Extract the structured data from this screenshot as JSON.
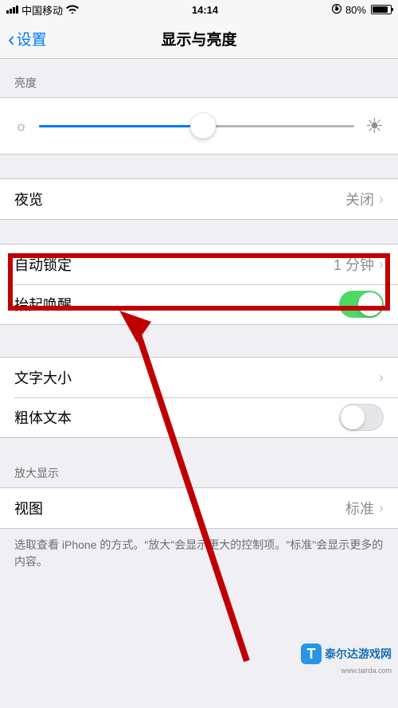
{
  "status_bar": {
    "carrier": "中国移动",
    "time": "14:14",
    "battery": "80%"
  },
  "nav": {
    "back": "设置",
    "title": "显示与亮度"
  },
  "sections": {
    "brightness_header": "亮度",
    "brightness_value": 52,
    "night_shift": {
      "label": "夜览",
      "value": "关闭"
    },
    "auto_lock": {
      "label": "自动锁定",
      "value": "1 分钟"
    },
    "raise_to_wake": {
      "label": "抬起唤醒",
      "on": true
    },
    "text_size": {
      "label": "文字大小"
    },
    "bold_text": {
      "label": "粗体文本",
      "on": false
    },
    "zoom_header": "放大显示",
    "view": {
      "label": "视图",
      "value": "标准"
    },
    "view_footer": "选取查看 iPhone 的方式。\"放大\"会显示更大的控制项。\"标准\"会显示更多的内容。"
  },
  "watermark": {
    "name": "泰尔达游戏网",
    "url": "www.tairda.com"
  }
}
